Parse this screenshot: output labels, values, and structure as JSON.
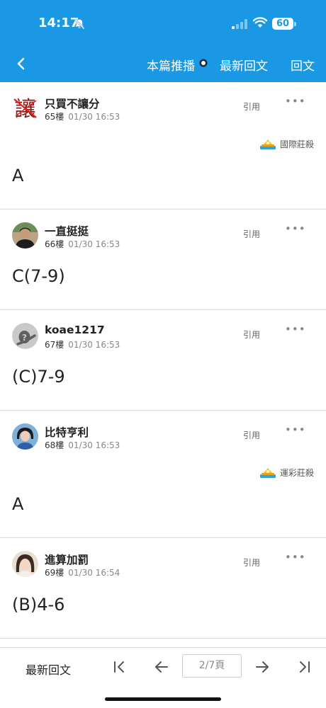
{
  "status_bar": {
    "time": "14:17",
    "battery": "60"
  },
  "header": {
    "push_label": "本篇推播",
    "latest_label": "最新回文",
    "reply_label": "回文"
  },
  "posts": [
    {
      "username": "只買不讓分",
      "floor": "65樓",
      "time": "01/30 16:53",
      "quote": "引用",
      "more": "•••",
      "badge": "國際莊殺",
      "content": "A"
    },
    {
      "username": "一直挺挺",
      "floor": "66樓",
      "time": "01/30 16:53",
      "quote": "引用",
      "more": "•••",
      "content": "C(7-9)"
    },
    {
      "username": "koae1217",
      "floor": "67樓",
      "time": "01/30 16:53",
      "quote": "引用",
      "more": "•••",
      "content": "(C)7-9"
    },
    {
      "username": "比特亨利",
      "floor": "68樓",
      "time": "01/30 16:53",
      "quote": "引用",
      "more": "•••",
      "badge": "運彩莊殺",
      "content": "A"
    },
    {
      "username": "進算加罰",
      "floor": "69樓",
      "time": "01/30 16:54",
      "quote": "引用",
      "more": "•••",
      "content": "(B)4-6"
    }
  ],
  "bottom_bar": {
    "latest_label": "最新回文",
    "page_label": "2/7頁"
  },
  "colors": {
    "header_bg": "#1a98e3",
    "divider": "#dcdcdc",
    "text": "#222222"
  }
}
